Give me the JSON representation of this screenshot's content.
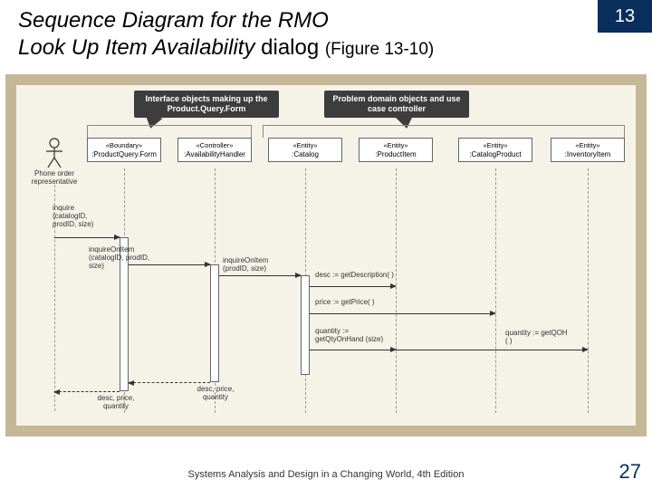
{
  "chapter": "13",
  "title_line1": "Sequence Diagram for the RMO",
  "title_line2a": "Look Up Item Availability",
  "title_line2b": " dialog ",
  "title_fig": "(Figure 13-10)",
  "callouts": {
    "c1": "Interface objects making up the Product.Query.Form",
    "c2": "Problem domain objects and use case controller"
  },
  "actor_label": "Phone order representative",
  "objects": {
    "o1_stereo": "«Boundary»",
    "o1_name": ":ProductQuery.Form",
    "o2_stereo": "«Controller»",
    "o2_name": ":AvailabilityHandler",
    "o3_stereo": "«Entity»",
    "o3_name": ":Catalog",
    "o4_stereo": "«Entity»",
    "o4_name": ":ProductItem",
    "o5_stereo": "«Entity»",
    "o5_name": ":CatalogProduct",
    "o6_stereo": "«Entity»",
    "o6_name": ":InventoryItem"
  },
  "messages": {
    "m1": "inquire (catalogID, prodID, size)",
    "m2": "inquireOnItem (catalogID, prodID, size)",
    "m3": "inquireOnItem (prodID, size)",
    "m4": "desc := getDescription( )",
    "m5": "price := getPrice( )",
    "m6": "quantity := getQtyOnHand (size)",
    "m7": "quantity := getQOH ( )",
    "r1": "desc, price, quantity",
    "r2": "desc, price, quantity"
  },
  "footer": "Systems Analysis and Design in a Changing World, 4th Edition",
  "page": "27"
}
